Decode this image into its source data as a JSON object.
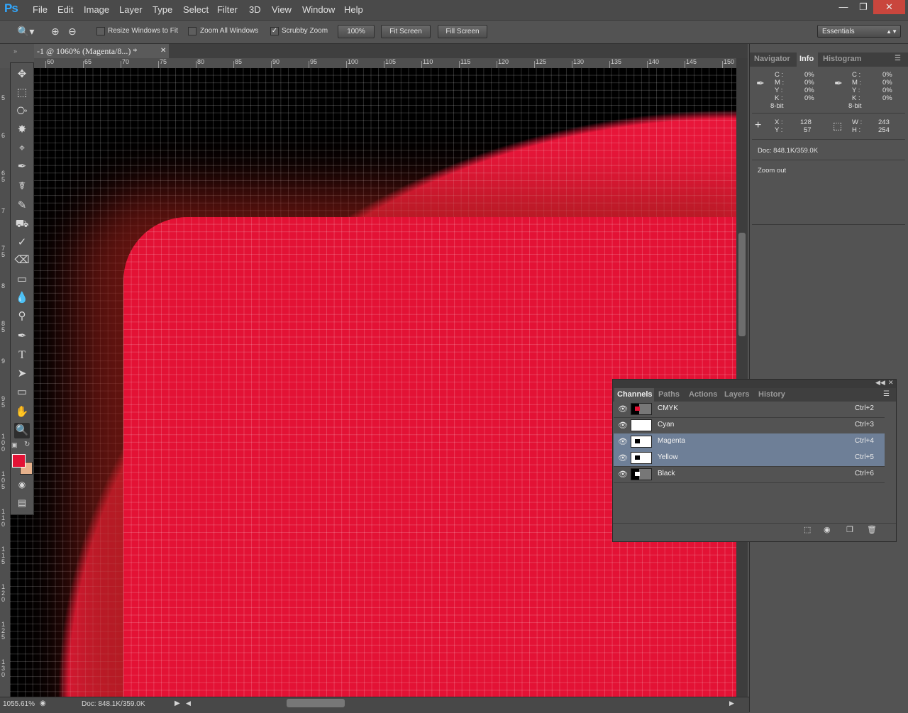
{
  "app": {
    "logo": "Ps",
    "menus": [
      "File",
      "Edit",
      "Image",
      "Layer",
      "Type",
      "Select",
      "Filter",
      "3D",
      "View",
      "Window",
      "Help"
    ],
    "window_controls": [
      "minimize",
      "restore",
      "close"
    ]
  },
  "options_bar": {
    "resize_windows_label": "Resize Windows to Fit",
    "zoom_all_label": "Zoom All Windows",
    "scrubby_label": "Scrubby Zoom",
    "resize_checked": false,
    "zoom_all_checked": false,
    "scrubby_checked": true,
    "btn_100": "100%",
    "btn_fit": "Fit Screen",
    "btn_fill": "Fill Screen",
    "workspace": "Essentials"
  },
  "document": {
    "tab_title": "-1 @ 1060% (Magenta/8...) *",
    "ruler_h": [
      "60",
      "65",
      "70",
      "75",
      "80",
      "85",
      "90",
      "95",
      "100",
      "105",
      "110",
      "115",
      "120",
      "125",
      "130",
      "135",
      "140",
      "145",
      "150"
    ],
    "ruler_v": [
      "5",
      "6",
      "6 5",
      "7",
      "7 5",
      "8",
      "8 5",
      "9",
      "9 5",
      "1 0 0",
      "1 0 5",
      "1 1 0",
      "1 1 5",
      "1 2 0",
      "1 2 5",
      "1 3 0"
    ],
    "zoom_status": "1055.61%",
    "doc_status": "Doc: 848.1K/359.0K"
  },
  "colors": {
    "foreground": "#e31235",
    "background": "#e7b28c",
    "canvas_red": "#e31235",
    "selection": "#6e7f97"
  },
  "info_panel": {
    "tabs": [
      "Navigator",
      "Info",
      "Histogram"
    ],
    "active_tab": "Info",
    "left_cmyk": {
      "C": "0%",
      "M": "0%",
      "Y": "0%",
      "K": "0%",
      "bit": "8-bit"
    },
    "right_cmyk": {
      "C": "0%",
      "M": "0%",
      "Y": "0%",
      "K": "0%",
      "bit": "8-bit"
    },
    "x_label": "X :",
    "x_value": "128",
    "y_label": "Y :",
    "y_value": "57",
    "w_label": "W :",
    "w_value": "243",
    "h_label": "H :",
    "h_value": "254",
    "doc": "Doc: 848.1K/359.0K",
    "hint": "Zoom out"
  },
  "channels_panel": {
    "tabs": [
      "Channels",
      "Paths",
      "Actions",
      "Layers",
      "History"
    ],
    "active_tab": "Channels",
    "rows": [
      {
        "name": "CMYK",
        "key": "Ctrl+2",
        "selected": false
      },
      {
        "name": "Cyan",
        "key": "Ctrl+3",
        "selected": false
      },
      {
        "name": "Magenta",
        "key": "Ctrl+4",
        "selected": true
      },
      {
        "name": "Yellow",
        "key": "Ctrl+5",
        "selected": true
      },
      {
        "name": "Black",
        "key": "Ctrl+6",
        "selected": false
      }
    ],
    "footer_icons": [
      "load-selection-icon",
      "save-selection-icon",
      "new-channel-icon",
      "delete-channel-icon"
    ]
  },
  "tools": [
    "move-tool",
    "marquee-tool",
    "lasso-tool",
    "magic-wand-tool",
    "crop-tool",
    "eyedropper-tool",
    "healing-brush-tool",
    "brush-tool",
    "clone-stamp-tool",
    "history-brush-tool",
    "eraser-tool",
    "gradient-tool",
    "blur-tool",
    "dodge-tool",
    "pen-tool",
    "type-tool",
    "path-selection-tool",
    "rectangle-tool",
    "hand-tool",
    "zoom-tool"
  ]
}
